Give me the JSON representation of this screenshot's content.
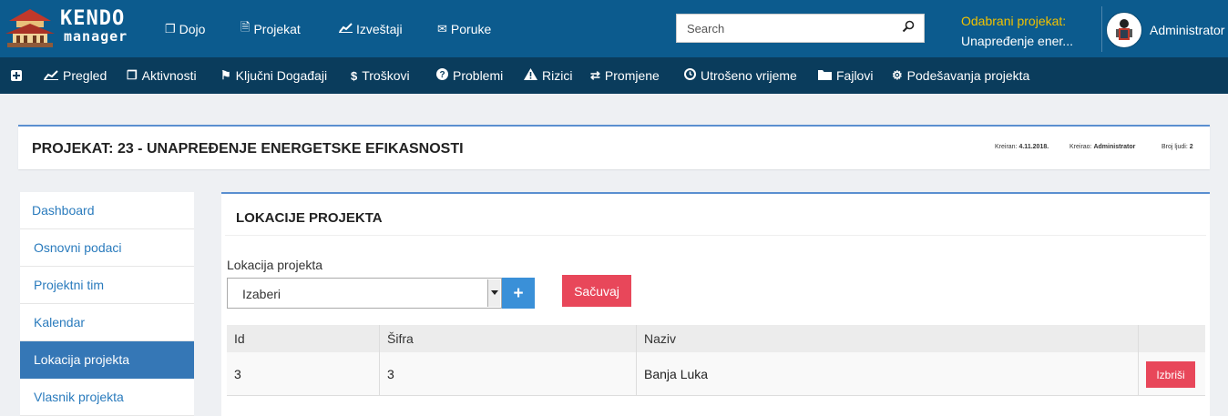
{
  "app": {
    "logo_line1": "KENDO",
    "logo_line2": "manager"
  },
  "topnav": [
    {
      "label": "Dojo",
      "icon": "copy-icon"
    },
    {
      "label": "Projekat",
      "icon": "file-text-icon"
    },
    {
      "label": "Izveštaji",
      "icon": "line-chart-icon"
    },
    {
      "label": "Poruke",
      "icon": "envelope-icon"
    }
  ],
  "search": {
    "placeholder": "Search",
    "value": ""
  },
  "project": {
    "label": "Odabrani projekat:",
    "value": "Unapređenje ener..."
  },
  "user": {
    "name": "Administrator"
  },
  "subnav": [
    {
      "label": "Pregled",
      "icon": "line-chart-icon"
    },
    {
      "label": "Aktivnosti",
      "icon": "files-icon"
    },
    {
      "label": "Ključni Događaji",
      "icon": "flag-icon"
    },
    {
      "label": "Troškovi",
      "icon": "dollar-icon"
    },
    {
      "label": "Problemi",
      "icon": "question-circle-icon"
    },
    {
      "label": "Rizici",
      "icon": "warning-icon"
    },
    {
      "label": "Promjene",
      "icon": "exchange-icon"
    },
    {
      "label": "Utrošeno vrijeme",
      "icon": "clock-icon"
    },
    {
      "label": "Fajlovi",
      "icon": "folder-icon"
    },
    {
      "label": "Podešavanja projekta",
      "icon": "cogs-icon"
    }
  ],
  "header": {
    "title": "PROJEKAT: 23 - UNAPREĐENJE ENERGETSKE EFIKASNOSTI",
    "created_label": "Kreiran:",
    "created_value": "4.11.2018.",
    "creator_label": "Kreirao:",
    "creator_value": "Administrator",
    "people_label": "Broj ljudi:",
    "people_value": "2"
  },
  "sidebar": {
    "items": [
      {
        "label": "Dashboard"
      },
      {
        "label": "Osnovni podaci"
      },
      {
        "label": "Projektni tim"
      },
      {
        "label": "Kalendar"
      },
      {
        "label": "Lokacija projekta"
      },
      {
        "label": "Vlasnik projekta"
      }
    ],
    "active_index": 4
  },
  "main": {
    "title": "LOKACIJE PROJEKTA",
    "field_label": "Lokacija projekta",
    "select_value": "Izaberi",
    "save_label": "Sačuvaj",
    "columns": [
      "Id",
      "Šifra",
      "Naziv",
      ""
    ],
    "rows": [
      {
        "id": "3",
        "sifra": "3",
        "naziv": "Banja Luka",
        "action": "Izbriši"
      }
    ]
  },
  "colors": {
    "topbar": "#0c5b8e",
    "subnav": "#0a3c5c",
    "accent": "#3577b6",
    "danger": "#e8475a",
    "project_label": "#f2c200"
  }
}
